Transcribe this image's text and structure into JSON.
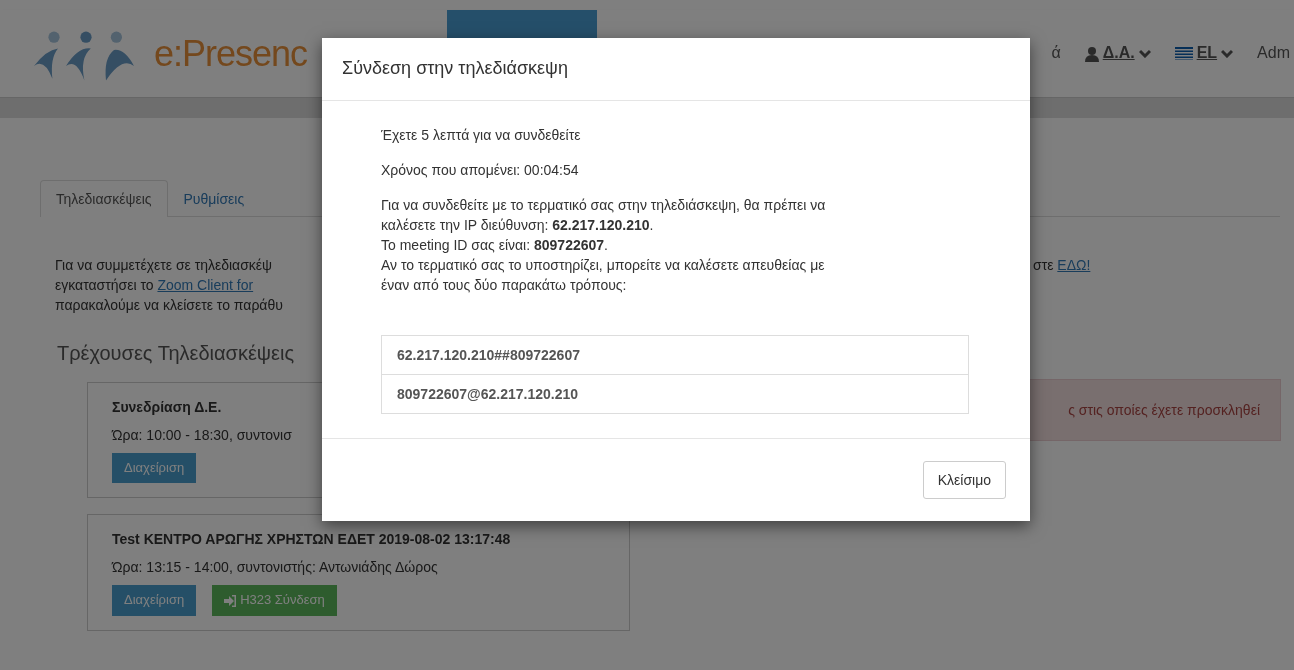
{
  "navbar": {
    "brand": "e:Presenc",
    "nav_fragment": "ά",
    "user_menu": "Δ.Α.",
    "language_menu": "EL",
    "admin_fragment": "Adm"
  },
  "tabs": [
    {
      "label": "Τηλεδιασκέψεις",
      "selected": true
    },
    {
      "label": "Ρυθμίσεις",
      "selected": false
    }
  ],
  "intro": {
    "lines": [
      {
        "text": "Για να συμμετέχετε σε τηλεδιασκέψ"
      },
      {
        "text": "εγκαταστήσει το ",
        "link": "Zoom Client for"
      },
      {
        "text": "παρακαλούμε να κλείσετε το παράθυ"
      }
    ],
    "right_text": "στε ",
    "right_link": "ΕΔΩ!"
  },
  "section_title": "Τρέχουσες Τηλεδιασκέψεις",
  "conferences": [
    {
      "title": "Συνεδρίαση Δ.Ε.",
      "time": "Ώρα: 10:00 - 18:30, συντονισ",
      "buttons": [
        {
          "kind": "manage",
          "label": "Διαχείριση"
        }
      ]
    },
    {
      "title": "Test ΚΕΝΤΡΟ ΑΡΩΓΗΣ ΧΡΗΣΤΩΝ ΕΔΕΤ 2019-08-02 13:17:48",
      "time": "Ώρα: 13:15 - 14:00, συντονιστής: Αντωνιάδης Δώρος",
      "buttons": [
        {
          "kind": "manage",
          "label": "Διαχείριση"
        },
        {
          "kind": "join",
          "label": "H323 Σύνδεση"
        }
      ]
    }
  ],
  "alert": "ς στις οποίες έχετε προσκληθεί",
  "modal": {
    "title": "Σύνδεση στην τηλεδιάσκεψη",
    "paragraphs": [
      "Έχετε 5 λεπτά για να συνδεθείτε",
      "Χρόνος που απομένει: 00:04:54"
    ],
    "instructions": [
      "Για να συνδεθείτε με το τερματικό σας στην τηλεδιάσκεψη, θα πρέπει να καλέσετε την IP διεύθυνση: **62.217.120.210**.",
      "Το meeting ID σας είναι: **809722607**.",
      "Αν το τερματικό σας το υποστηρίζει, μπορείτε να καλέσετε απευθείας με έναν από τους δύο παρακάτω τρόπους:"
    ],
    "dial_strings": [
      "62.217.120.210##809722607",
      "809722607@62.217.120.210"
    ],
    "close_button": "Κλείσιμο"
  }
}
